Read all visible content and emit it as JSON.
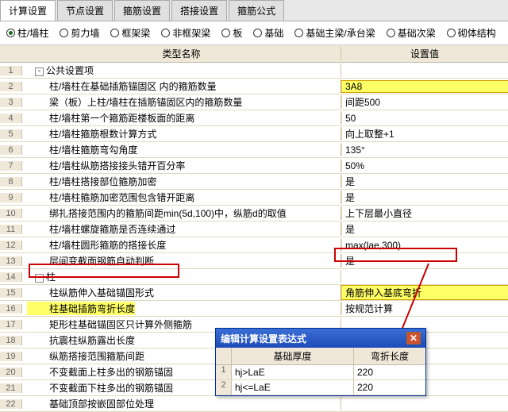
{
  "tabs": [
    "计算设置",
    "节点设置",
    "箍筋设置",
    "搭接设置",
    "箍筋公式"
  ],
  "active_tab": 0,
  "radios": [
    "柱/墙柱",
    "剪力墙",
    "框架梁",
    "非框架梁",
    "板",
    "基础",
    "基础主梁/承台梁",
    "基础次梁",
    "砌体结构"
  ],
  "active_radio": 0,
  "header": {
    "name": "类型名称",
    "val": "设置值"
  },
  "rows": [
    {
      "n": "1",
      "toggle": "-",
      "name": "公共设置项",
      "val": "",
      "lvl": 0
    },
    {
      "n": "2",
      "name": "柱/墙柱在基础插筋锚固区 内的箍筋数量",
      "val": "3A8",
      "lvl": 1,
      "hl": true
    },
    {
      "n": "3",
      "name": "梁（板）上柱/墙柱在插筋锚固区内的箍筋数量",
      "val": "间距500",
      "lvl": 1
    },
    {
      "n": "4",
      "name": "柱/墙柱第一个箍筋距楼板面的距离",
      "val": "50",
      "lvl": 1
    },
    {
      "n": "5",
      "name": "柱/墙柱箍筋根数计算方式",
      "val": "向上取整+1",
      "lvl": 1
    },
    {
      "n": "6",
      "name": "柱/墙柱箍筋弯勾角度",
      "val": "135°",
      "lvl": 1
    },
    {
      "n": "7",
      "name": "柱/墙柱纵筋搭接接头错开百分率",
      "val": "50%",
      "lvl": 1
    },
    {
      "n": "8",
      "name": "柱/墙柱搭接部位箍筋加密",
      "val": "是",
      "lvl": 1
    },
    {
      "n": "9",
      "name": "柱/墙柱箍筋加密范围包含错开距离",
      "val": "是",
      "lvl": 1
    },
    {
      "n": "10",
      "name": "绑扎搭接范围内的箍筋间距min(5d,100)中，纵筋d的取值",
      "val": "上下层最小直径",
      "lvl": 1
    },
    {
      "n": "11",
      "name": "柱/墙柱螺旋箍筋是否连续通过",
      "val": "是",
      "lvl": 1
    },
    {
      "n": "12",
      "name": "柱/墙柱圆形箍筋的搭接长度",
      "val": "max(lae,300)",
      "lvl": 1
    },
    {
      "n": "13",
      "name": "层间变截面钢筋自动判断",
      "val": "是",
      "lvl": 1
    },
    {
      "n": "14",
      "toggle": "-",
      "name": "柱",
      "val": "",
      "lvl": 0
    },
    {
      "n": "15",
      "name": "柱纵筋伸入基础锚固形式",
      "val": "角筋伸入基底弯折",
      "lvl": 1,
      "hl": true
    },
    {
      "n": "16",
      "name": "柱基础插筋弯折长度",
      "val": "按规范计算",
      "lvl": 1,
      "hl_name": true
    },
    {
      "n": "17",
      "name": "矩形柱基础锚固区只计算外侧箍筋",
      "val": "",
      "lvl": 1
    },
    {
      "n": "18",
      "name": "抗震柱纵筋露出长度",
      "val": "",
      "lvl": 1
    },
    {
      "n": "19",
      "name": "纵筋搭接范围箍筋间距",
      "val": "",
      "lvl": 1
    },
    {
      "n": "20",
      "name": "不变截面上柱多出的钢筋锚固",
      "val": "",
      "lvl": 1
    },
    {
      "n": "21",
      "name": "不变截面下柱多出的钢筋锚固",
      "val": "",
      "lvl": 1
    },
    {
      "n": "22",
      "name": "基础顶部按嵌固部位处理",
      "val": "",
      "lvl": 1
    }
  ],
  "dialog": {
    "title": "编辑计算设置表达式",
    "col_a": "基础厚度",
    "col_b": "弯折长度",
    "rows": [
      {
        "n": "1",
        "a": "hj>LaE",
        "b": "220"
      },
      {
        "n": "2",
        "a": "hj<=LaE",
        "b": "220"
      }
    ]
  }
}
